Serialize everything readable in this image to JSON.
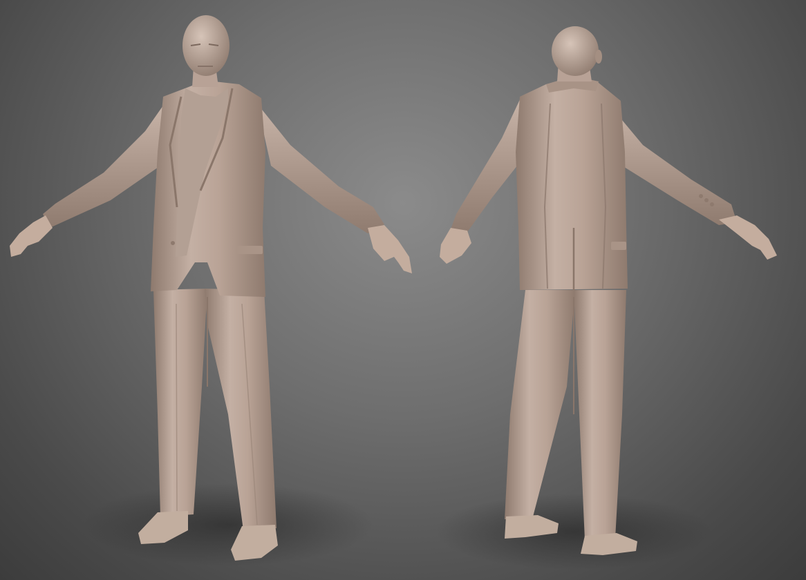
{
  "scene": {
    "subject": "render",
    "figures": [
      {
        "view": "front",
        "icon": "figure-front-icon"
      },
      {
        "view": "back",
        "icon": "figure-back-icon"
      }
    ],
    "colors": {
      "background_light": "#8b8b8b",
      "background_dark": "#3c3c3c",
      "clay": "#b9a396",
      "clay_shadow": "#8e7a6e",
      "clay_highlight": "#d2c0b4"
    }
  }
}
